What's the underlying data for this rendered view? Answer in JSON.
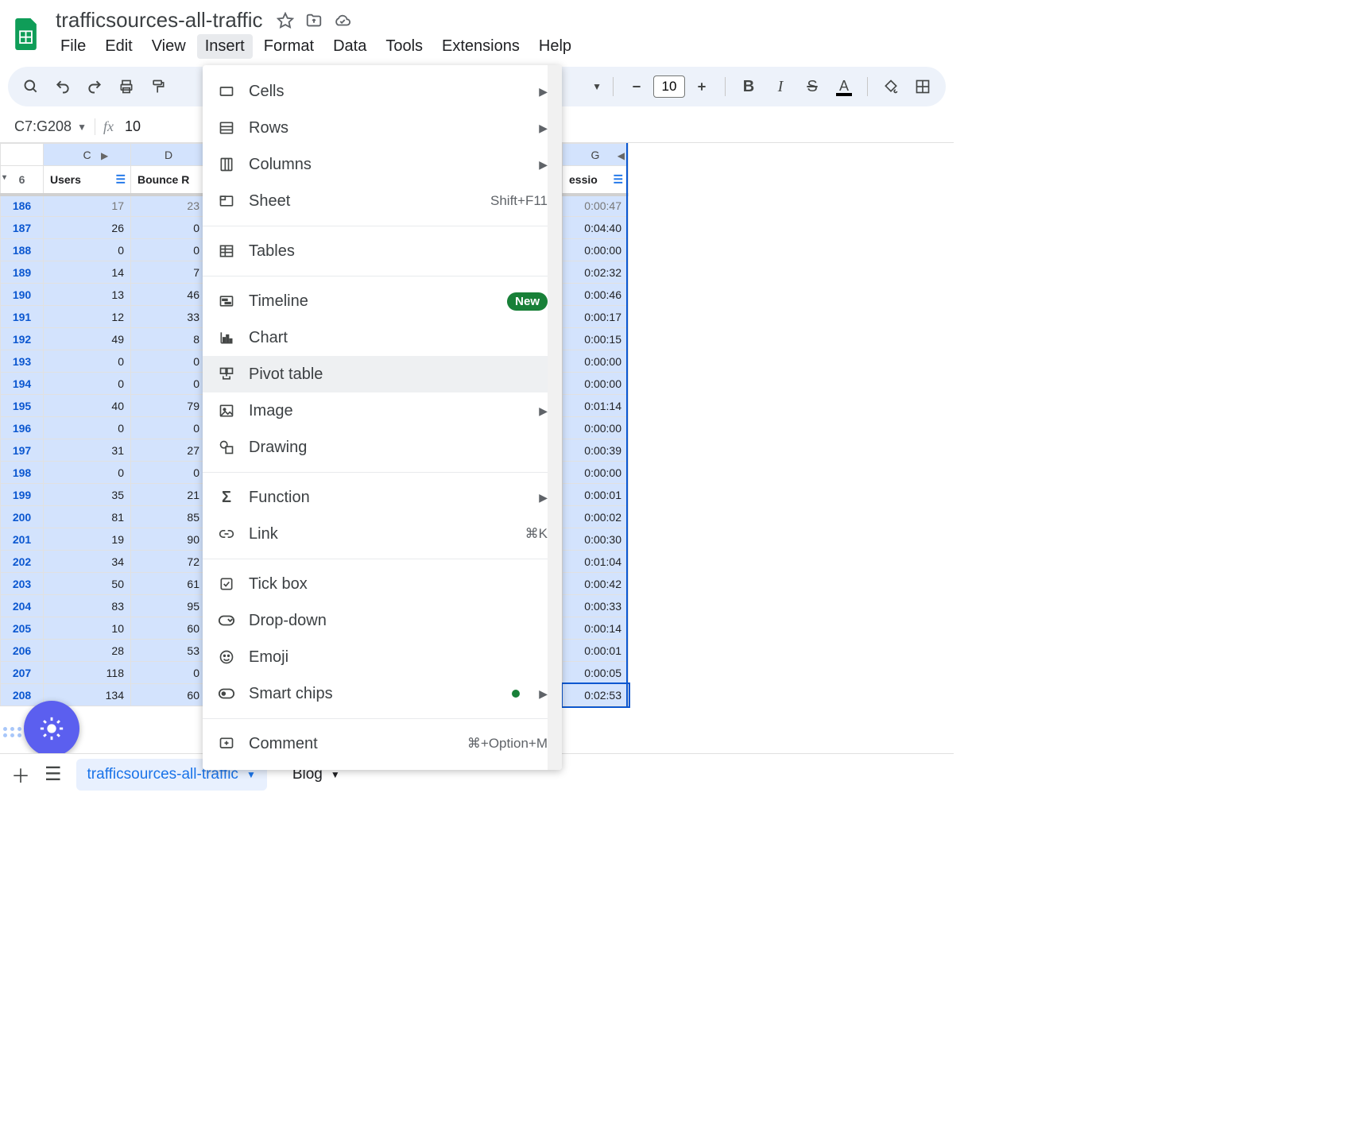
{
  "doc": {
    "title": "trafficsources-all-traffic"
  },
  "menus": [
    "File",
    "Edit",
    "View",
    "Insert",
    "Format",
    "Data",
    "Tools",
    "Extensions",
    "Help"
  ],
  "active_menu_index": 3,
  "toolbar": {
    "font_size": "10"
  },
  "namebox": {
    "value": "C7:G208"
  },
  "formula": {
    "value": "10"
  },
  "columns": [
    "C",
    "D",
    "G"
  ],
  "header_row_number": "6",
  "headers": {
    "c": "Users",
    "d": "Bounce R",
    "g": "essio"
  },
  "rows": [
    {
      "n": "186",
      "c": "17",
      "d": "23",
      "g": "0:00:47"
    },
    {
      "n": "187",
      "c": "26",
      "d": "0",
      "g": "0:04:40"
    },
    {
      "n": "188",
      "c": "0",
      "d": "0",
      "g": "0:00:00"
    },
    {
      "n": "189",
      "c": "14",
      "d": "7",
      "g": "0:02:32"
    },
    {
      "n": "190",
      "c": "13",
      "d": "46",
      "g": "0:00:46"
    },
    {
      "n": "191",
      "c": "12",
      "d": "33",
      "g": "0:00:17"
    },
    {
      "n": "192",
      "c": "49",
      "d": "8",
      "g": "0:00:15"
    },
    {
      "n": "193",
      "c": "0",
      "d": "0",
      "g": "0:00:00"
    },
    {
      "n": "194",
      "c": "0",
      "d": "0",
      "g": "0:00:00"
    },
    {
      "n": "195",
      "c": "40",
      "d": "79",
      "g": "0:01:14"
    },
    {
      "n": "196",
      "c": "0",
      "d": "0",
      "g": "0:00:00"
    },
    {
      "n": "197",
      "c": "31",
      "d": "27",
      "g": "0:00:39"
    },
    {
      "n": "198",
      "c": "0",
      "d": "0",
      "g": "0:00:00"
    },
    {
      "n": "199",
      "c": "35",
      "d": "21",
      "g": "0:00:01"
    },
    {
      "n": "200",
      "c": "81",
      "d": "85",
      "g": "0:00:02"
    },
    {
      "n": "201",
      "c": "19",
      "d": "90",
      "g": "0:00:30"
    },
    {
      "n": "202",
      "c": "34",
      "d": "72",
      "g": "0:01:04"
    },
    {
      "n": "203",
      "c": "50",
      "d": "61",
      "g": "0:00:42"
    },
    {
      "n": "204",
      "c": "83",
      "d": "95",
      "g": "0:00:33"
    },
    {
      "n": "205",
      "c": "10",
      "d": "60",
      "g": "0:00:14"
    },
    {
      "n": "206",
      "c": "28",
      "d": "53",
      "g": "0:00:01"
    },
    {
      "n": "207",
      "c": "118",
      "d": "0",
      "g": "0:00:05"
    },
    {
      "n": "208",
      "c": "134",
      "d": "60",
      "g": "0:02:53"
    }
  ],
  "insert_menu": {
    "cells": "Cells",
    "rows": "Rows",
    "columns": "Columns",
    "sheet": "Sheet",
    "sheet_shortcut": "Shift+F11",
    "tables": "Tables",
    "timeline": "Timeline",
    "timeline_badge": "New",
    "chart": "Chart",
    "pivot": "Pivot table",
    "image": "Image",
    "drawing": "Drawing",
    "function": "Function",
    "link": "Link",
    "link_shortcut": "⌘K",
    "tickbox": "Tick box",
    "dropdown": "Drop-down",
    "emoji": "Emoji",
    "smartchips": "Smart chips",
    "comment": "Comment",
    "comment_shortcut": "⌘+Option+M"
  },
  "sheets": {
    "active": "trafficsources-all-traffic",
    "other": "Blog"
  }
}
